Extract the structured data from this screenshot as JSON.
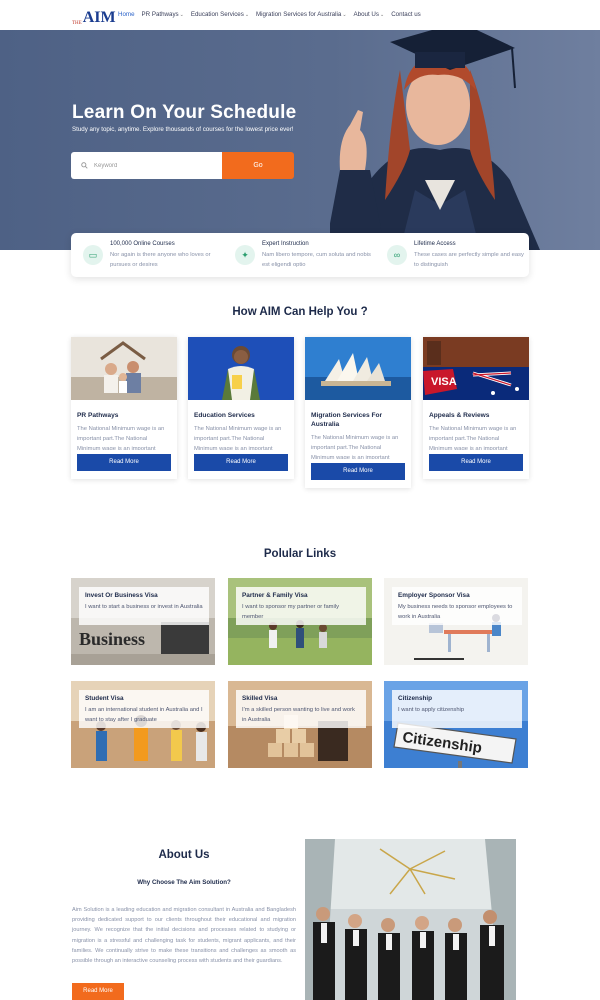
{
  "nav": {
    "logo_small": "THE",
    "logo_text": "AIM",
    "items": [
      {
        "label": "Home",
        "active": true,
        "dropdown": false
      },
      {
        "label": "PR Pathways",
        "active": false,
        "dropdown": true
      },
      {
        "label": "Education Services",
        "active": false,
        "dropdown": true
      },
      {
        "label": "Migration Services for Australia",
        "active": false,
        "dropdown": true
      },
      {
        "label": "About Us",
        "active": false,
        "dropdown": true
      },
      {
        "label": "Contact us",
        "active": false,
        "dropdown": false
      }
    ]
  },
  "hero": {
    "title": "Learn On Your Schedule",
    "subtitle": "Study any topic, anytime. Explore thousands of courses for the lowest price ever!",
    "search_placeholder": "Keyword",
    "search_button": "Go"
  },
  "features": [
    {
      "title": "100,000 Online Courses",
      "desc": "Nor again is there anyone who loves or pursues or desires",
      "icon": "video-icon"
    },
    {
      "title": "Expert Instruction",
      "desc": "Nam libero tempore, cum soluta and nobis est eligendi optio",
      "icon": "bulb-icon"
    },
    {
      "title": "Lifetime Access",
      "desc": "These cases are perfectly simple and easy to distinguish",
      "icon": "infinity-icon"
    }
  ],
  "help": {
    "title": "How AIM Can Help You ?",
    "cards": [
      {
        "title": "PR Pathways",
        "text": "The National Minimum wage is an important part.The National Minimum wage is an important",
        "button": "Read More"
      },
      {
        "title": "Education Services",
        "text": "The National Minimum wage is an important part.The National Minimum wage is an important",
        "button": "Read More"
      },
      {
        "title": "Migration Services For Australia",
        "text": "The National Minimum wage is an important part.The National Minimum wage is an important",
        "button": "Read More"
      },
      {
        "title": "Appeals & Reviews",
        "text": "The National Minimum wage is an important part.The National Minimum wage is an important",
        "button": "Read More"
      }
    ]
  },
  "popular": {
    "title": "Polular Links",
    "links": [
      {
        "title": "Invest Or Business Visa",
        "text": "I want to start a business or invest in Australia",
        "image_text": "Business"
      },
      {
        "title": "Partner & Family Visa",
        "text": "I want to sponsor my partner or family member",
        "image_text": ""
      },
      {
        "title": "Employer Sponsor Visa",
        "text": "My business needs to sponsor employees to work in Australia",
        "image_text": ""
      },
      {
        "title": "Student Visa",
        "text": "I am an international student in Australia and I want to stay after I graduate",
        "image_text": ""
      },
      {
        "title": "Skilled Visa",
        "text": "I'm a skilled person wanting to live and work in Australia",
        "image_text": ""
      },
      {
        "title": "Citizenship",
        "text": "I want to apply citizenship",
        "image_text": "Citizenship"
      }
    ]
  },
  "about": {
    "title": "About Us",
    "subtitle": "Why Choose The Aim Solution?",
    "text": "Aim Solution is a leading education and migration consultant in Australia and Bangladesh providing dedicated support to our clients throughout their educational and migration journey. We recognize that the initial decisions and processes related to studying or migration is a stressful and challenging task for students, migrant applicants, and their families. We continually strive to make these transitions and challenges as smooth as possible through an interactive counseling process with students and their guardians.",
    "button": "Read More"
  }
}
